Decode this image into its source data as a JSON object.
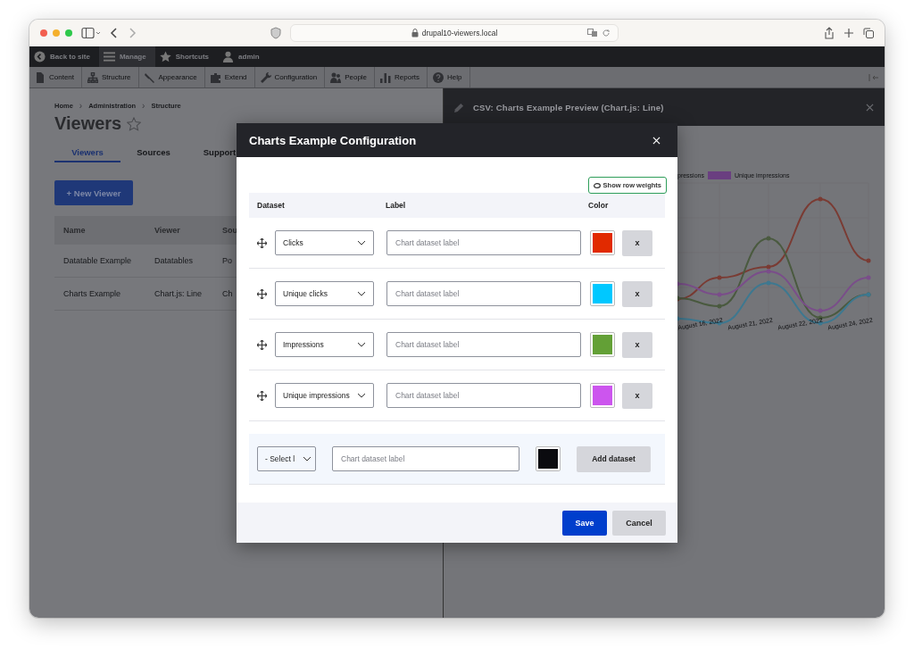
{
  "browser": {
    "url": "drupal10-viewers.local"
  },
  "toolbar": [
    {
      "label": "Back to site",
      "kind": "back",
      "selected": false
    },
    {
      "label": "Manage",
      "kind": "menu",
      "selected": true
    },
    {
      "label": "Shortcuts",
      "kind": "star",
      "selected": false
    },
    {
      "label": "admin",
      "kind": "user",
      "selected": false
    }
  ],
  "menu": [
    {
      "label": "Content",
      "kind": "file"
    },
    {
      "label": "Structure",
      "kind": "tree"
    },
    {
      "label": "Appearance",
      "kind": "brush"
    },
    {
      "label": "Extend",
      "kind": "puzzle"
    },
    {
      "label": "Configuration",
      "kind": "wrench"
    },
    {
      "label": "People",
      "kind": "people"
    },
    {
      "label": "Reports",
      "kind": "bars"
    },
    {
      "label": "Help",
      "kind": "help"
    }
  ],
  "page": {
    "breadcrumb": [
      {
        "label": "Home",
        "kind": "link"
      },
      {
        "label": "›",
        "kind": "separator"
      },
      {
        "label": "Administration",
        "kind": "link"
      },
      {
        "label": "›",
        "kind": "separator"
      },
      {
        "label": "Structure",
        "kind": "link"
      }
    ],
    "title": "Viewers",
    "tabs": [
      {
        "label": "Viewers",
        "selected": true
      },
      {
        "label": "Sources",
        "selected": false
      },
      {
        "label": "Support",
        "selected": false
      }
    ],
    "new_button": "+ New Viewer",
    "table": {
      "columns": [
        "Name",
        "Viewer",
        "Sou"
      ],
      "rows": [
        [
          "Datatable Example",
          "Datatables",
          "Po"
        ],
        [
          "Charts Example",
          "Chart.js: Line",
          "Ch"
        ]
      ]
    }
  },
  "preview": {
    "title": "CSV: Charts Example Preview (Chart.js: Line)",
    "legend": [
      {
        "label": "pressions"
      },
      {
        "label": "Unique impressions",
        "color": "#6a3f80"
      }
    ],
    "x_labels": [
      "August 16, 2022",
      "August 21, 2022",
      "August 22, 2022",
      "August 24, 2022"
    ]
  },
  "modal": {
    "title": "Charts Example Configuration",
    "weights_button": "Show row weights",
    "columns": [
      "Dataset",
      "Label",
      "Color"
    ],
    "rows": [
      {
        "dataset": "Clicks",
        "placeholder": "Chart dataset label",
        "color": "#e12a00",
        "remove": "x"
      },
      {
        "dataset": "Unique clicks",
        "placeholder": "Chart dataset label",
        "color": "#00c8ff",
        "remove": "x"
      },
      {
        "dataset": "Impressions",
        "placeholder": "Chart dataset label",
        "color": "#63a036",
        "remove": "x"
      },
      {
        "dataset": "Unique impressions",
        "placeholder": "Chart dataset label",
        "color": "#cc55ee",
        "remove": "x"
      }
    ],
    "add_row": {
      "select": "- Select l",
      "placeholder": "Chart dataset label",
      "color": "#0b0b0f",
      "button": "Add dataset"
    },
    "buttons": [
      {
        "label": "Save",
        "kind": "primary"
      },
      {
        "label": "Cancel",
        "kind": "secondary"
      }
    ]
  }
}
